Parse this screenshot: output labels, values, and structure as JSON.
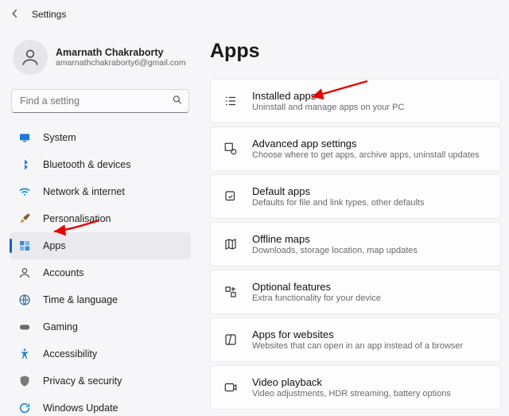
{
  "window": {
    "title": "Settings"
  },
  "account": {
    "name": "Amarnath Chakraborty",
    "email": "amarnathchakraborty6@gmail.com"
  },
  "search": {
    "placeholder": "Find a setting"
  },
  "sidebar": {
    "items": [
      {
        "label": "System"
      },
      {
        "label": "Bluetooth & devices"
      },
      {
        "label": "Network & internet"
      },
      {
        "label": "Personalisation"
      },
      {
        "label": "Apps"
      },
      {
        "label": "Accounts"
      },
      {
        "label": "Time & language"
      },
      {
        "label": "Gaming"
      },
      {
        "label": "Accessibility"
      },
      {
        "label": "Privacy & security"
      },
      {
        "label": "Windows Update"
      }
    ],
    "selected_index": 4
  },
  "page": {
    "title": "Apps"
  },
  "cards": [
    {
      "title": "Installed apps",
      "desc": "Uninstall and manage apps on your PC"
    },
    {
      "title": "Advanced app settings",
      "desc": "Choose where to get apps, archive apps, uninstall updates"
    },
    {
      "title": "Default apps",
      "desc": "Defaults for file and link types, other defaults"
    },
    {
      "title": "Offline maps",
      "desc": "Downloads, storage location, map updates"
    },
    {
      "title": "Optional features",
      "desc": "Extra functionality for your device"
    },
    {
      "title": "Apps for websites",
      "desc": "Websites that can open in an app instead of a browser"
    },
    {
      "title": "Video playback",
      "desc": "Video adjustments, HDR streaming, battery options"
    }
  ],
  "annotation": {
    "arrow_color": "#e60000"
  }
}
